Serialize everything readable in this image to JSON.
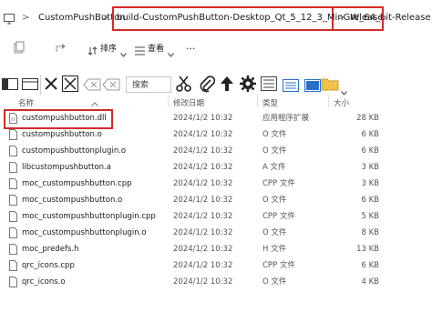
{
  "address": {
    "crumbs": [
      "CustomPushButton",
      "build-CustomPushButton-Desktop_Qt_5_12_3_MinGW_64_bit-Release",
      "release"
    ],
    "sep": ">"
  },
  "toolbar": {
    "sort_label": "排序",
    "view_label": "查看",
    "more_label": "..."
  },
  "ribbon": {
    "search_label": "搜索"
  },
  "columns": {
    "name": "名称",
    "date": "修改日期",
    "type": "类型",
    "size": "大小"
  },
  "files": [
    {
      "name": "custompushbutton.dll",
      "date": "2024/1/2 10:32",
      "type": "应用程序扩展",
      "size": "28 KB"
    },
    {
      "name": "custompushbutton.o",
      "date": "2024/1/2 10:32",
      "type": "O 文件",
      "size": "6 KB"
    },
    {
      "name": "custompushbuttonplugin.o",
      "date": "2024/1/2 10:32",
      "type": "O 文件",
      "size": "6 KB"
    },
    {
      "name": "libcustompushbutton.a",
      "date": "2024/1/2 10:32",
      "type": "A 文件",
      "size": "3 KB"
    },
    {
      "name": "moc_custompushbutton.cpp",
      "date": "2024/1/2 10:32",
      "type": "CPP 文件",
      "size": "3 KB"
    },
    {
      "name": "moc_custompushbutton.o",
      "date": "2024/1/2 10:32",
      "type": "O 文件",
      "size": "6 KB"
    },
    {
      "name": "moc_custompushbuttonplugin.cpp",
      "date": "2024/1/2 10:32",
      "type": "CPP 文件",
      "size": "5 KB"
    },
    {
      "name": "moc_custompushbuttonplugin.o",
      "date": "2024/1/2 10:32",
      "type": "O 文件",
      "size": "8 KB"
    },
    {
      "name": "moc_predefs.h",
      "date": "2024/1/2 10:32",
      "type": "H 文件",
      "size": "13 KB"
    },
    {
      "name": "qrc_icons.cpp",
      "date": "2024/1/2 10:32",
      "type": "CPP 文件",
      "size": "6 KB"
    },
    {
      "name": "qrc_icons.o",
      "date": "2024/1/2 10:32",
      "type": "O 文件",
      "size": "4 KB"
    }
  ]
}
